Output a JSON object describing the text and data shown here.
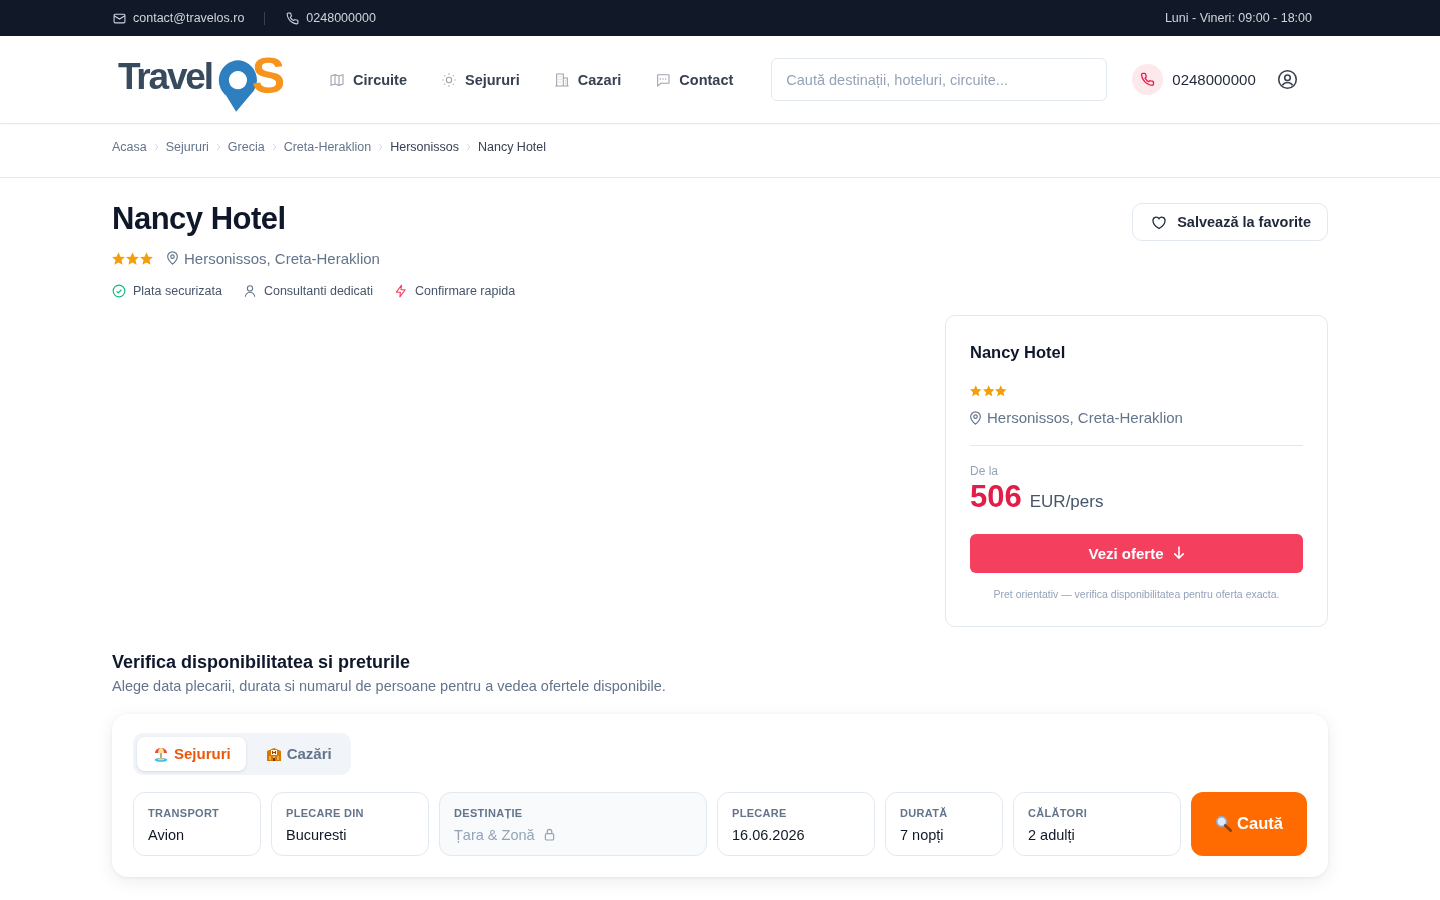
{
  "topbar": {
    "email": "contact@travelos.ro",
    "phone": "0248000000",
    "hours": "Luni - Vineri: 09:00 - 18:00"
  },
  "header": {
    "logo": {
      "text": "Travel",
      "accent": "S"
    },
    "nav": [
      {
        "label": "Circuite"
      },
      {
        "label": "Sejururi"
      },
      {
        "label": "Cazari"
      },
      {
        "label": "Contact"
      }
    ],
    "search": {
      "placeholder": "Caută destinații, hoteluri, circuite..."
    },
    "phone": "0248000000"
  },
  "breadcrumb": [
    "Acasa",
    "Sejururi",
    "Grecia",
    "Creta-Heraklion",
    "Hersonissos",
    "Nancy Hotel"
  ],
  "hotel": {
    "title": "Nancy Hotel",
    "stars": 3,
    "location": "Hersonissos, Creta-Heraklion",
    "features": [
      "Plata securizata",
      "Consultanti dedicati",
      "Confirmare rapida"
    ],
    "save_button": "Salvează la favorite"
  },
  "price_card": {
    "title": "Nancy Hotel",
    "stars": 3,
    "location": "Hersonissos, Creta-Heraklion",
    "from_label": "De la",
    "price": "506",
    "unit": "EUR/pers",
    "button": "Vezi oferte",
    "note": "Pret orientativ — verifica disponibilitatea pentru oferta exacta."
  },
  "availability": {
    "title": "Verifica disponibilitatea si preturile",
    "subtitle": "Alege data plecarii, durata si numarul de persoane pentru a vedea ofertele disponibile.",
    "tabs": [
      {
        "label": "Sejururi",
        "selected": true
      },
      {
        "label": "Cazări",
        "selected": false
      }
    ],
    "fields": [
      {
        "label": "TRANSPORT",
        "value": "Avion",
        "disabled": false
      },
      {
        "label": "PLECARE DIN",
        "value": "Bucuresti",
        "disabled": false
      },
      {
        "label": "DESTINAȚIE",
        "value": "Țara & Zonă",
        "disabled": true
      },
      {
        "label": "PLECARE",
        "value": "16.06.2026",
        "disabled": false
      },
      {
        "label": "DURATĂ",
        "value": "7 nopți",
        "disabled": false
      },
      {
        "label": "CĂLĂTORI",
        "value": "2 adulți",
        "disabled": false
      }
    ],
    "search_button": "Caută"
  }
}
